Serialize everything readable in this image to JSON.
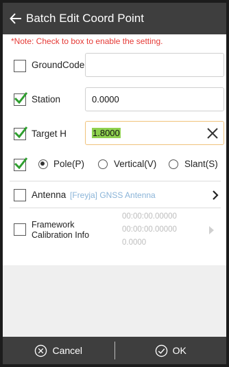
{
  "header": {
    "title": "Batch Edit Coord Point"
  },
  "note": "*Note: Check to box to enable the setting.",
  "ground_code": {
    "label": "GroundCode",
    "value": "",
    "checked": false
  },
  "station": {
    "label": "Station",
    "value": "0.0000",
    "checked": true
  },
  "target_h": {
    "label": "Target H",
    "value": "1.8000",
    "checked": true
  },
  "measure_mode": {
    "checked": true,
    "options": [
      {
        "label": "Pole(P)",
        "selected": true
      },
      {
        "label": "Vertical(V)",
        "selected": false
      },
      {
        "label": "Slant(S)",
        "selected": false
      }
    ]
  },
  "antenna": {
    "label": "Antenna",
    "value": "[Freyja] GNSS Antenna",
    "checked": false
  },
  "framework": {
    "label_line1": "Framework",
    "label_line2": "Calibration Info",
    "values": [
      "00:00:00.00000",
      "00:00:00.00000",
      "0.0000"
    ],
    "checked": false
  },
  "footer": {
    "cancel_label": "Cancel",
    "ok_label": "OK"
  },
  "colors": {
    "header_bg": "#3e3e3e",
    "check_green": "#2e9e2e",
    "note_red": "#e53935",
    "selection": "#8fd14f"
  }
}
